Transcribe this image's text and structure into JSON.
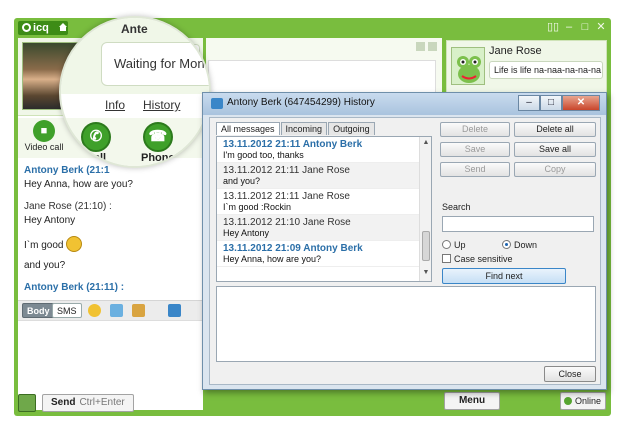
{
  "app": {
    "logo_text": "icq",
    "brand_color": "#79bd3e",
    "accent_blue": "#2b6fa8"
  },
  "contact": {
    "name_partial": "Ante",
    "status_message": "Waiting for Mon",
    "links": {
      "info": "Info",
      "history": "History"
    },
    "actions": {
      "video": "Video call",
      "call": "Call",
      "phone": "Phone"
    }
  },
  "chat": {
    "messages": [
      {
        "head": "Antony Berk (21:1",
        "body": "Hey Anna, how are you?",
        "style": "blue"
      },
      {
        "head": "Jane Rose (21:10) :",
        "body": "Hey Antony",
        "style": "gray"
      },
      {
        "head": "",
        "body": "I`m good",
        "style": "none",
        "emoji": true
      },
      {
        "head": "",
        "body": "and you?",
        "style": "none"
      },
      {
        "head": "Antony Berk (21:11) :",
        "body": "",
        "style": "blue"
      }
    ],
    "toolbar": {
      "body": "Body",
      "sms": "SMS"
    },
    "send_label": "Send",
    "send_shortcut": "Ctrl+Enter"
  },
  "jane": {
    "name": "Jane Rose",
    "status": "Life is life na-naa-na-na-na!"
  },
  "footer": {
    "menu": "Menu",
    "online": "Online"
  },
  "history_window": {
    "title": "Antony Berk (647454299) History",
    "controls": {
      "minimize": "–",
      "maximize": "□",
      "close": "✕"
    },
    "tabs": [
      "All messages",
      "Incoming",
      "Outgoing"
    ],
    "entries": [
      {
        "head": "13.11.2012 21:11 Antony Berk",
        "text": "I'm good too, thanks",
        "kind": "blue"
      },
      {
        "head": "13.11.2012 21:11 Jane Rose",
        "text": "and you?",
        "kind": "gray"
      },
      {
        "head": "13.11.2012 21:11 Jane Rose",
        "text": "I`m good :Rockin",
        "kind": "gray"
      },
      {
        "head": "13.11.2012 21:10 Jane Rose",
        "text": "Hey Antony",
        "kind": "gray"
      },
      {
        "head": "13.11.2012 21:09 Antony Berk",
        "text": "Hey Anna, how are you?",
        "kind": "blue"
      }
    ],
    "buttons": {
      "delete": "Delete",
      "delete_all": "Delete all",
      "save": "Save",
      "save_all": "Save all",
      "send": "Send",
      "copy": "Copy"
    },
    "search": {
      "label": "Search",
      "value": "",
      "up": "Up",
      "down": "Down",
      "case_sensitive": "Case sensitive",
      "find_next": "Find next"
    },
    "close": "Close"
  }
}
